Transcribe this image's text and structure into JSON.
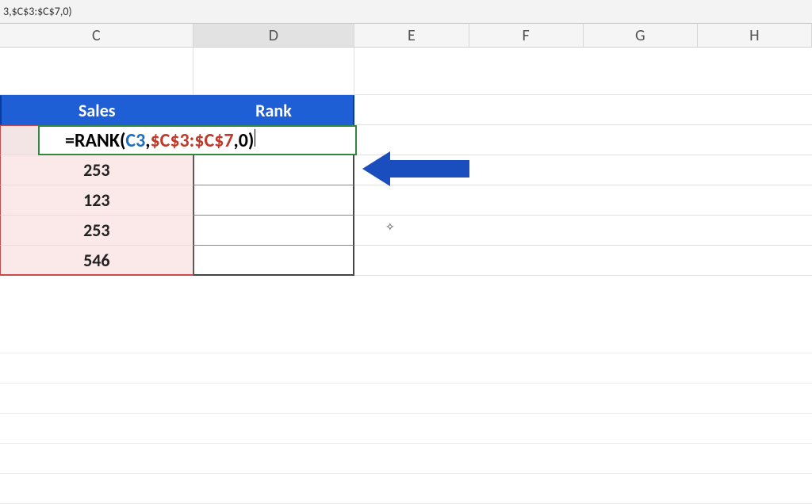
{
  "formula_bar": {
    "text": "3,$C$3:$C$7,0)"
  },
  "columns": [
    "C",
    "D",
    "E",
    "F",
    "G",
    "H"
  ],
  "selected_column": "D",
  "headers": {
    "sales": "Sales",
    "rank": "Rank"
  },
  "formula_parts": {
    "prefix": "=RANK(",
    "ref1": "C3",
    "comma1": ",",
    "range": "$C$3:$C$7",
    "comma2": ",",
    "arg3": "0",
    "suffix": ")"
  },
  "sales_values": [
    "253",
    "123",
    "253",
    "546"
  ],
  "arrow_color": "#1a4dbd"
}
